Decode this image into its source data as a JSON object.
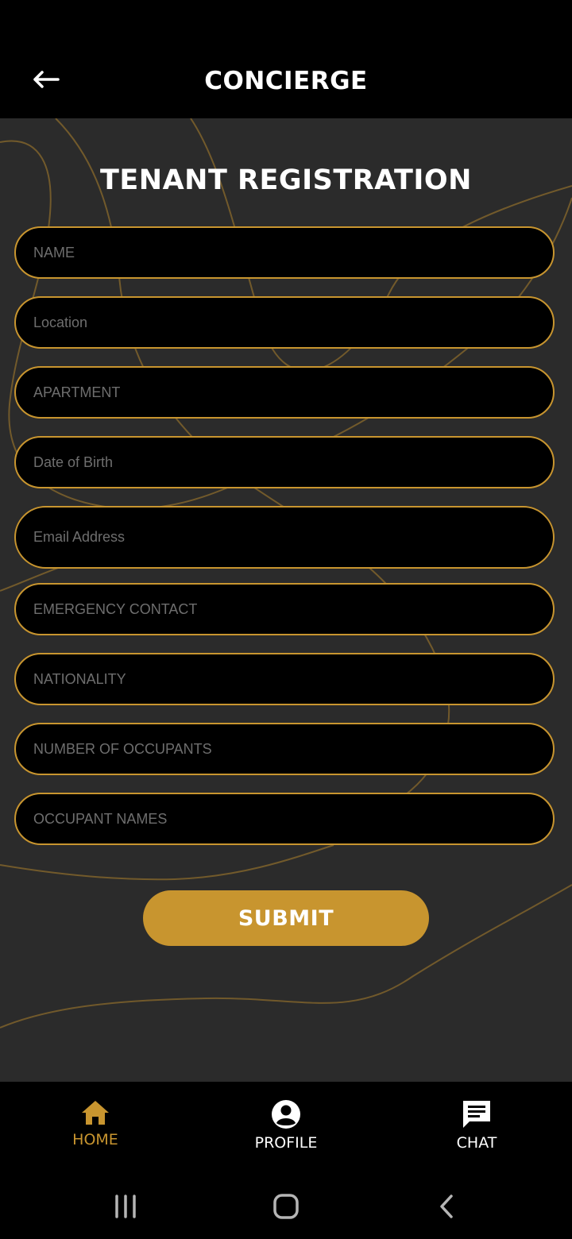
{
  "header": {
    "title": "CONCIERGE",
    "back_icon": "arrow-left-icon"
  },
  "form": {
    "title": "TENANT REGISTRATION",
    "fields": [
      {
        "placeholder": "NAME",
        "value": ""
      },
      {
        "placeholder": "Location",
        "value": ""
      },
      {
        "placeholder": "APARTMENT",
        "value": ""
      },
      {
        "placeholder": "Date of Birth",
        "value": ""
      },
      {
        "placeholder": "Email Address",
        "value": ""
      },
      {
        "placeholder": "EMERGENCY CONTACT",
        "value": ""
      },
      {
        "placeholder": "NATIONALITY",
        "value": ""
      },
      {
        "placeholder": "NUMBER OF OCCUPANTS",
        "value": ""
      },
      {
        "placeholder": "OCCUPANT NAMES",
        "value": ""
      }
    ],
    "submit_label": "SUBMIT"
  },
  "bottom_nav": {
    "items": [
      {
        "label": "HOME",
        "icon": "home-icon",
        "active": true
      },
      {
        "label": "PROFILE",
        "icon": "profile-icon",
        "active": false
      },
      {
        "label": "CHAT",
        "icon": "chat-icon",
        "active": false
      }
    ]
  },
  "system_nav": {
    "icons": [
      "recent-apps-icon",
      "home-circle-icon",
      "back-chevron-icon"
    ]
  },
  "colors": {
    "accent": "#c8952f",
    "background": "#2b2b2b",
    "bar": "#000000",
    "text": "#ffffff"
  }
}
